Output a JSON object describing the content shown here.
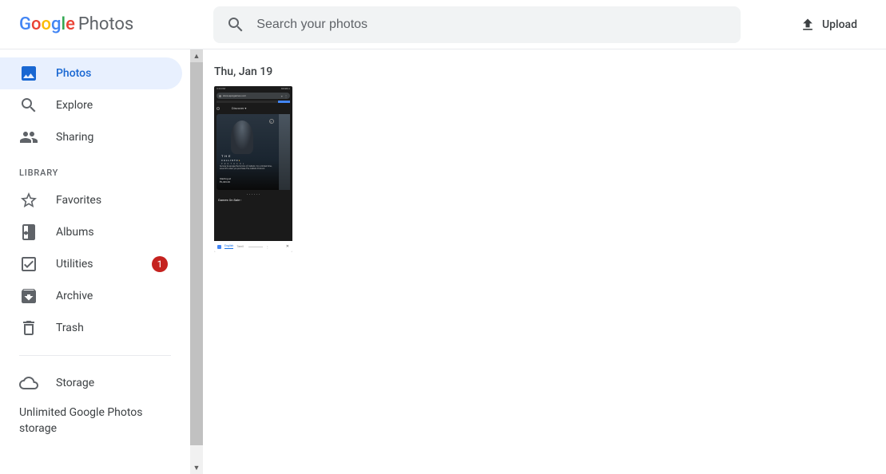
{
  "header": {
    "logo_product": "Photos",
    "search_placeholder": "Search your photos",
    "upload_label": "Upload"
  },
  "sidebar": {
    "nav": [
      {
        "label": "Photos"
      },
      {
        "label": "Explore"
      },
      {
        "label": "Sharing"
      }
    ],
    "library_label": "LIBRARY",
    "library": [
      {
        "label": "Favorites"
      },
      {
        "label": "Albums"
      },
      {
        "label": "Utilities",
        "badge": "1"
      },
      {
        "label": "Archive"
      },
      {
        "label": "Trash"
      }
    ],
    "storage_label": "Storage",
    "storage_text": "Unlimited Google Photos storage"
  },
  "main": {
    "date_group": "Thu, Jan 19",
    "thumbnail": {
      "status_time": "3:43 PM",
      "status_net": "300kB/s",
      "url": "store.epicgames.com",
      "discover": "Discover ▾",
      "game_title_line1": "T H E",
      "game_title_line2": "CALLISTO",
      "game_subtitle": "P R O T O C O L",
      "desc": "Survive to escape the horrors of Callisto. For a limited time, save 20% when you purchase The Callisto Protocol.",
      "price_label": "Starting at",
      "price": "₹2,499.00",
      "sale_label": "Games On Sale ›",
      "bottom_tab1": "English",
      "bottom_tab2": "Tamil"
    }
  }
}
